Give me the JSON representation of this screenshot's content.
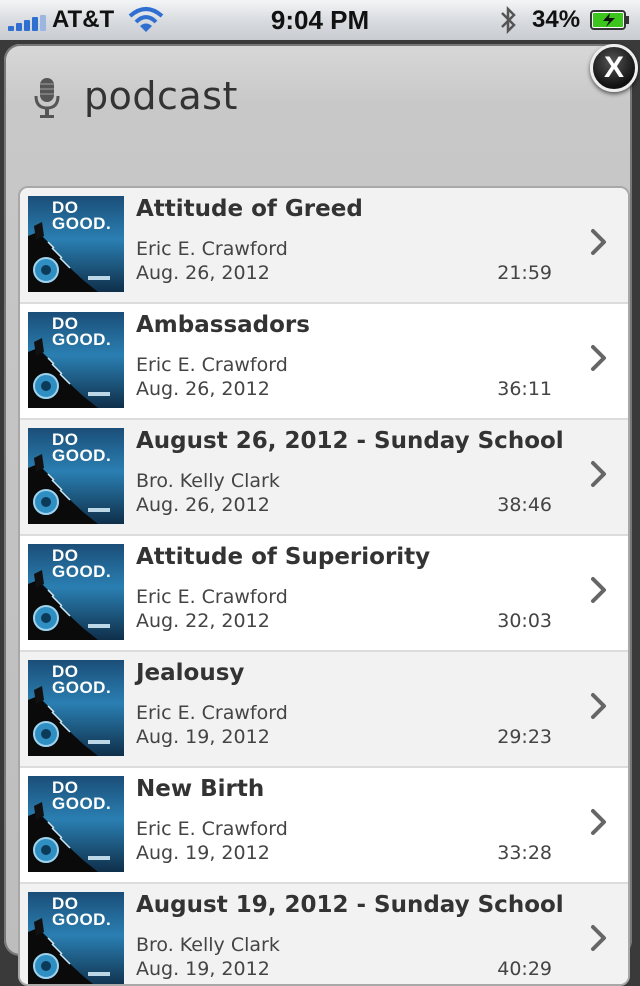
{
  "status_bar": {
    "carrier": "AT&T",
    "time": "9:04 PM",
    "battery_percent": "34%",
    "icons": [
      "signal-bars-icon",
      "wifi-icon",
      "bluetooth-icon",
      "battery-charging-icon"
    ],
    "battery_level": 0.34
  },
  "panel": {
    "title": "podcast",
    "close_label": "X",
    "icon": "microphone-icon"
  },
  "episodes": [
    {
      "title": "Attitude of Greed",
      "author": "Eric E. Crawford",
      "date": "Aug. 26, 2012",
      "duration": "21:59",
      "thumb_text": "DO GOOD."
    },
    {
      "title": "Ambassadors",
      "author": "Eric E. Crawford",
      "date": "Aug. 26, 2012",
      "duration": "36:11",
      "thumb_text": "DO GOOD."
    },
    {
      "title": "August 26, 2012 - Sunday School",
      "author": "Bro. Kelly Clark",
      "date": "Aug. 26, 2012",
      "duration": "38:46",
      "thumb_text": "DO GOOD."
    },
    {
      "title": "Attitude of Superiority",
      "author": "Eric E. Crawford",
      "date": "Aug. 22, 2012",
      "duration": "30:03",
      "thumb_text": "DO GOOD."
    },
    {
      "title": "Jealousy",
      "author": "Eric E. Crawford",
      "date": "Aug. 19, 2012",
      "duration": "29:23",
      "thumb_text": "DO GOOD."
    },
    {
      "title": "New Birth",
      "author": "Eric E. Crawford",
      "date": "Aug. 19, 2012",
      "duration": "33:28",
      "thumb_text": "DO GOOD."
    },
    {
      "title": "August 19, 2012 - Sunday School",
      "author": "Bro. Kelly Clark",
      "date": "Aug. 19, 2012",
      "duration": "40:29",
      "thumb_text": "DO GOOD."
    }
  ],
  "colors": {
    "signal_blue": "#2f6fd1",
    "battery_green": "#3cc51c",
    "panel_bg": "#c8c8c8",
    "text_dark": "#333333"
  }
}
